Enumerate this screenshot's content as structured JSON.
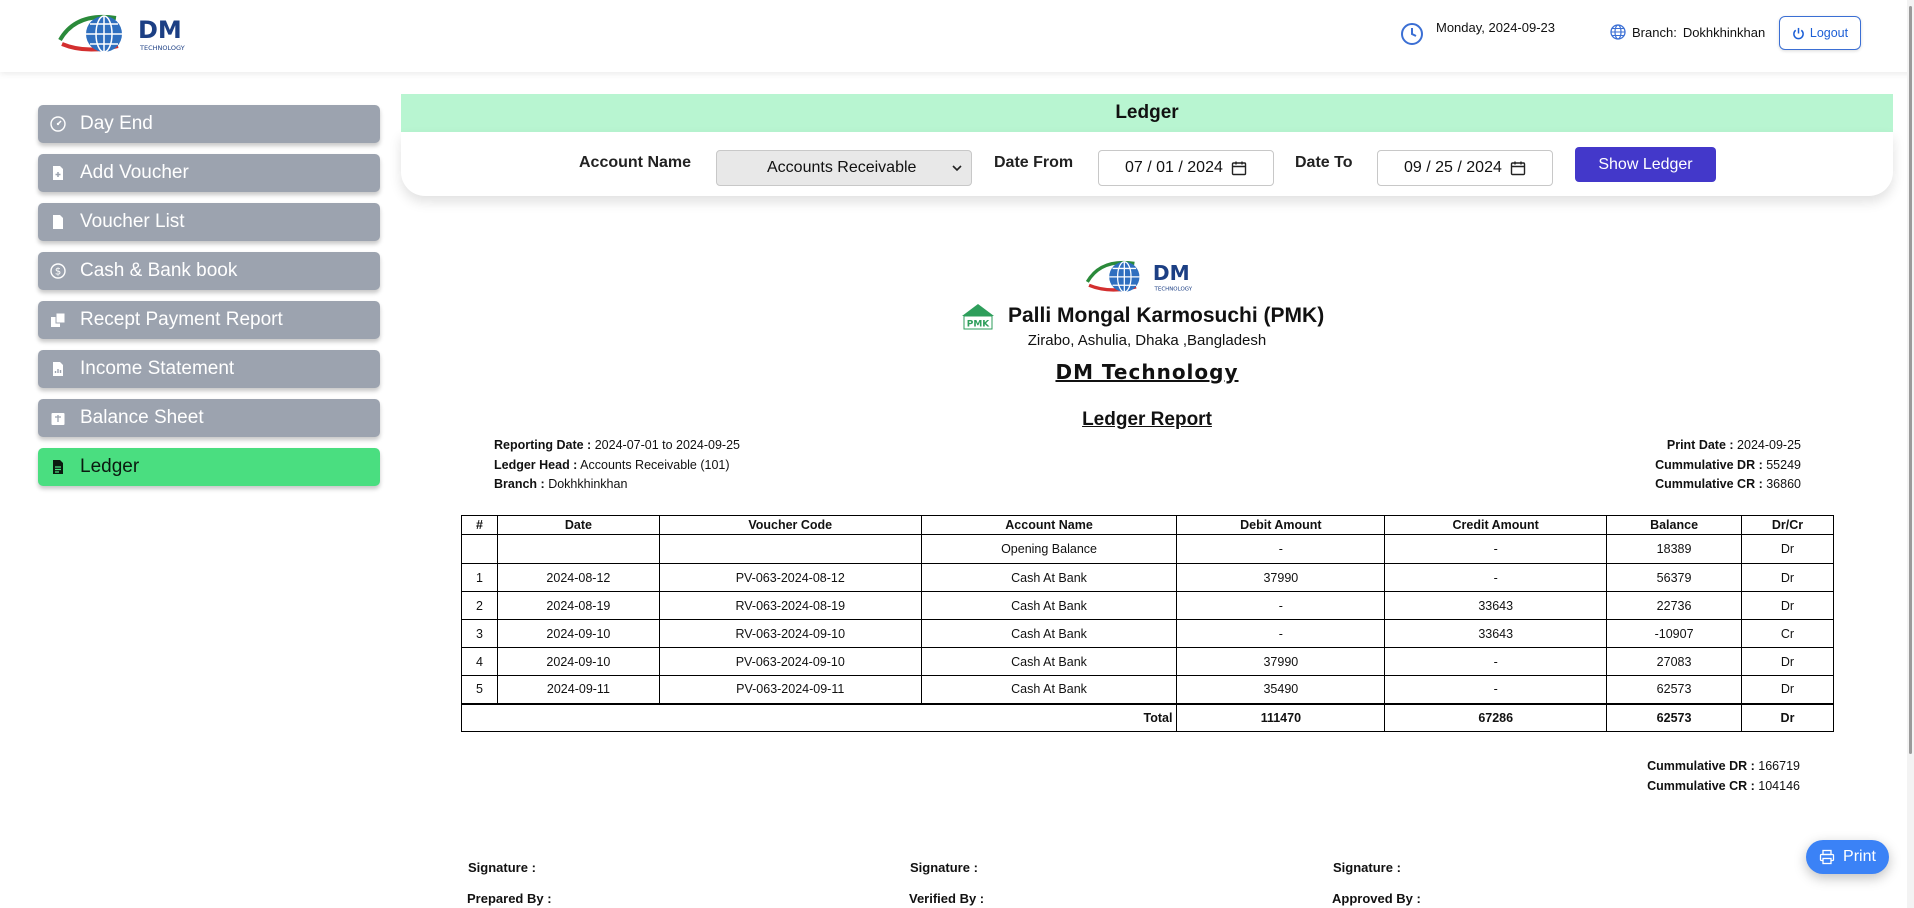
{
  "header": {
    "logo_text": "DM",
    "logo_sub": "TECHNOLOGY",
    "date": "Monday, 2024-09-23",
    "branch_label": "Branch:",
    "branch_value": "Dokhkhinkhan",
    "logout_label": "Logout"
  },
  "sidebar": {
    "items": [
      {
        "label": "Day End",
        "icon": "gauge-icon"
      },
      {
        "label": "Add Voucher",
        "icon": "file-plus-icon"
      },
      {
        "label": "Voucher List",
        "icon": "file-icon"
      },
      {
        "label": "Cash & Bank book",
        "icon": "dollar-coin-icon"
      },
      {
        "label": "Recept Payment Report",
        "icon": "receipt-icon"
      },
      {
        "label": "Income Statement",
        "icon": "file-chart-icon"
      },
      {
        "label": "Balance Sheet",
        "icon": "balance-icon"
      },
      {
        "label": "Ledger",
        "icon": "file-text-icon",
        "active": true
      }
    ]
  },
  "page": {
    "title": "Ledger"
  },
  "filters": {
    "account_label": "Account Name",
    "account_value": "Accounts Receivable",
    "date_from_label": "Date From",
    "date_from_value": "07 / 01 / 2024",
    "date_to_label": "Date To",
    "date_to_value": "09 / 25 / 2024",
    "show_button": "Show Ledger"
  },
  "report": {
    "logo_text": "DM",
    "logo_sub": "TECHNOLOGY",
    "pmk_badge": "PMK",
    "org_name": "Palli Mongal Karmosuchi (PMK)",
    "address": "Zirabo, Ashulia, Dhaka ,Bangladesh",
    "company": "DM Technology",
    "title": "Ledger Report",
    "reporting_date_label": "Reporting Date :",
    "reporting_date_value": "2024-07-01 to 2024-09-25",
    "ledger_head_label": "Ledger Head :",
    "ledger_head_value": "Accounts Receivable (101)",
    "branch_label": "Branch :",
    "branch_value": "Dokhkhinkhan",
    "print_date_label": "Print Date :",
    "print_date_value": "2024-09-25",
    "cum_dr_label": "Cummulative DR :",
    "cum_dr_value": "55249",
    "cum_cr_label": "Cummulative CR :",
    "cum_cr_value": "36860",
    "table": {
      "headers": [
        "#",
        "Date",
        "Voucher Code",
        "Account Name",
        "Debit Amount",
        "Credit Amount",
        "Balance",
        "Dr/Cr"
      ],
      "rows": [
        [
          "",
          "",
          "",
          "Opening Balance",
          "-",
          "-",
          "18389",
          "Dr"
        ],
        [
          "1",
          "2024-08-12",
          "PV-063-2024-08-12",
          "Cash At Bank",
          "37990",
          "-",
          "56379",
          "Dr"
        ],
        [
          "2",
          "2024-08-19",
          "RV-063-2024-08-19",
          "Cash At Bank",
          "-",
          "33643",
          "22736",
          "Dr"
        ],
        [
          "3",
          "2024-09-10",
          "RV-063-2024-09-10",
          "Cash At Bank",
          "-",
          "33643",
          "-10907",
          "Cr"
        ],
        [
          "4",
          "2024-09-10",
          "PV-063-2024-09-10",
          "Cash At Bank",
          "37990",
          "-",
          "27083",
          "Dr"
        ],
        [
          "5",
          "2024-09-11",
          "PV-063-2024-09-11",
          "Cash At Bank",
          "35490",
          "-",
          "62573",
          "Dr"
        ]
      ],
      "total": {
        "label": "Total",
        "debit": "111470",
        "credit": "67286",
        "balance": "62573",
        "drcr": "Dr"
      }
    },
    "bottom_cum_dr_label": "Cummulative DR :",
    "bottom_cum_dr_value": "166719",
    "bottom_cum_cr_label": "Cummulative CR :",
    "bottom_cum_cr_value": "104146",
    "signatures": {
      "sig_label": "Signature :",
      "prepared": "Prepared By :",
      "verified": "Verified By :",
      "approved": "Approved By :"
    }
  },
  "print_button": "Print",
  "colors": {
    "sidebar_item": "#9ca3af",
    "sidebar_active": "#4ade80",
    "title_bar": "#b8f5d1",
    "show_button": "#4338ca",
    "print_button": "#3b82f6",
    "logout_border": "#3b6fd4"
  }
}
